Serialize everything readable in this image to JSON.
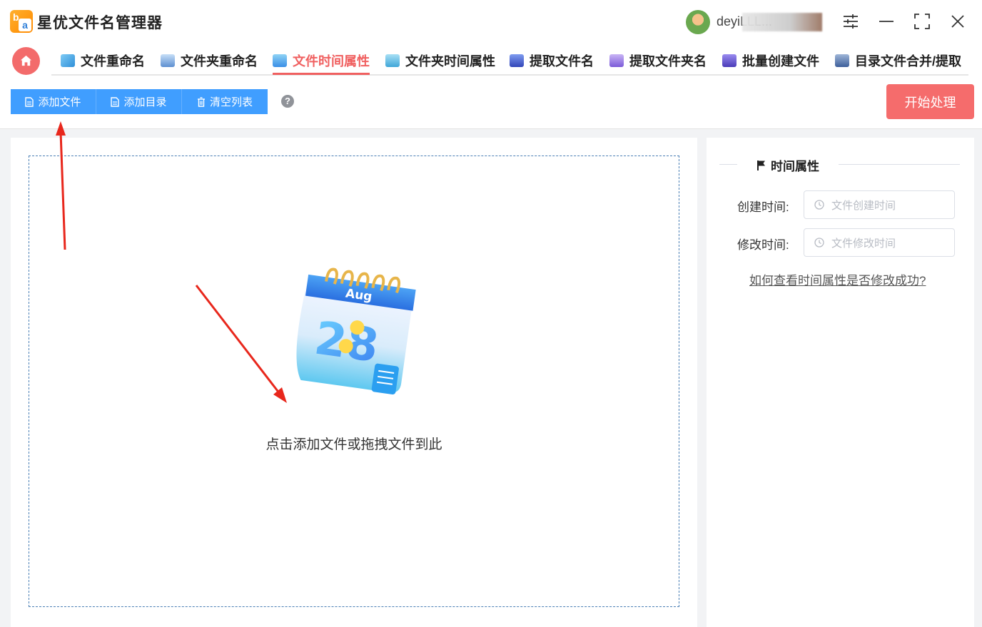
{
  "app": {
    "title": "星优文件名管理器",
    "username": "deyiLLL..."
  },
  "nav": {
    "tabs": [
      {
        "label": "文件重命名",
        "icon": "document-rename-icon",
        "active": false
      },
      {
        "label": "文件夹重命名",
        "icon": "folder-rename-icon",
        "active": false
      },
      {
        "label": "文件时间属性",
        "icon": "file-time-icon",
        "active": true
      },
      {
        "label": "文件夹时间属性",
        "icon": "folder-time-icon",
        "active": false
      },
      {
        "label": "提取文件名",
        "icon": "extract-filename-icon",
        "active": false
      },
      {
        "label": "提取文件夹名",
        "icon": "extract-foldername-icon",
        "active": false
      },
      {
        "label": "批量创建文件",
        "icon": "batch-create-icon",
        "active": false
      },
      {
        "label": "目录文件合并/提取",
        "icon": "merge-extract-icon",
        "active": false
      }
    ]
  },
  "toolbar": {
    "add_file": "添加文件",
    "add_dir": "添加目录",
    "clear_list": "清空列表",
    "help": "?",
    "start": "开始处理"
  },
  "drop": {
    "hint": "点击添加文件或拖拽文件到此",
    "calendar_month": "Aug",
    "calendar_day": "28"
  },
  "side": {
    "section_title": "时间属性",
    "created_label": "创建时间:",
    "created_placeholder": "文件创建时间",
    "modified_label": "修改时间:",
    "modified_placeholder": "文件修改时间",
    "help_link": "如何查看时间属性是否修改成功?"
  },
  "colors": {
    "accent_red": "#f56c6c",
    "active_tab": "#f06060",
    "primary_blue": "#409eff"
  }
}
